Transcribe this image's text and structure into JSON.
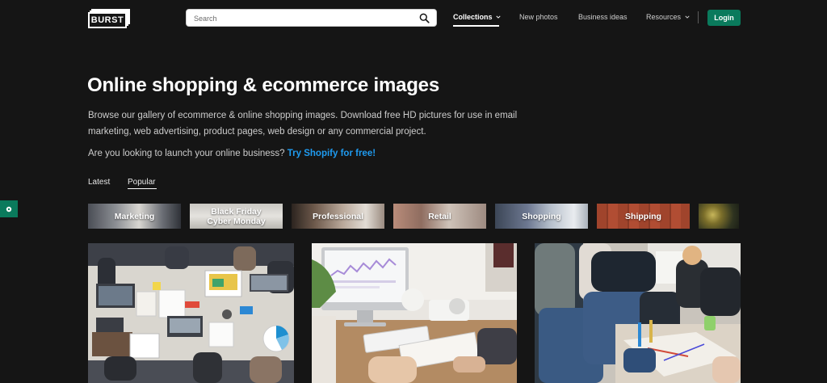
{
  "header": {
    "logo": "BURST",
    "search_placeholder": "Search",
    "nav": [
      "Collections",
      "New photos",
      "Business ideas",
      "Resources"
    ],
    "login_label": "Login"
  },
  "hero": {
    "title": "Online shopping & ecommerce images",
    "description": "Browse our gallery of ecommerce & online shopping images. Download free HD pictures for use in email marketing, web advertising, product pages, web design or any commercial project.",
    "cta_prefix": "Are you looking to launch your online business?",
    "cta_link": "Try Shopify for free!"
  },
  "tabs": [
    "Latest",
    "Popular"
  ],
  "active_tab": "Popular",
  "categories": [
    {
      "label": "Marketing"
    },
    {
      "label": "Black Friday Cyber Monday"
    },
    {
      "label": "Professional"
    },
    {
      "label": "Retail"
    },
    {
      "label": "Shopping"
    },
    {
      "label": "Shipping"
    },
    {
      "label": ""
    }
  ],
  "photos": [
    {
      "subject": "team meeting around white table with laptops, charts and sticky notes"
    },
    {
      "subject": "desk with iMac, keyboard, plant and person sketching on paper"
    },
    {
      "subject": "group of people in jeans working on drawings on a wooden table"
    }
  ],
  "colors": {
    "background": "#151515",
    "accent_green": "#0a7a5c",
    "link_blue": "#1f9bf0"
  }
}
